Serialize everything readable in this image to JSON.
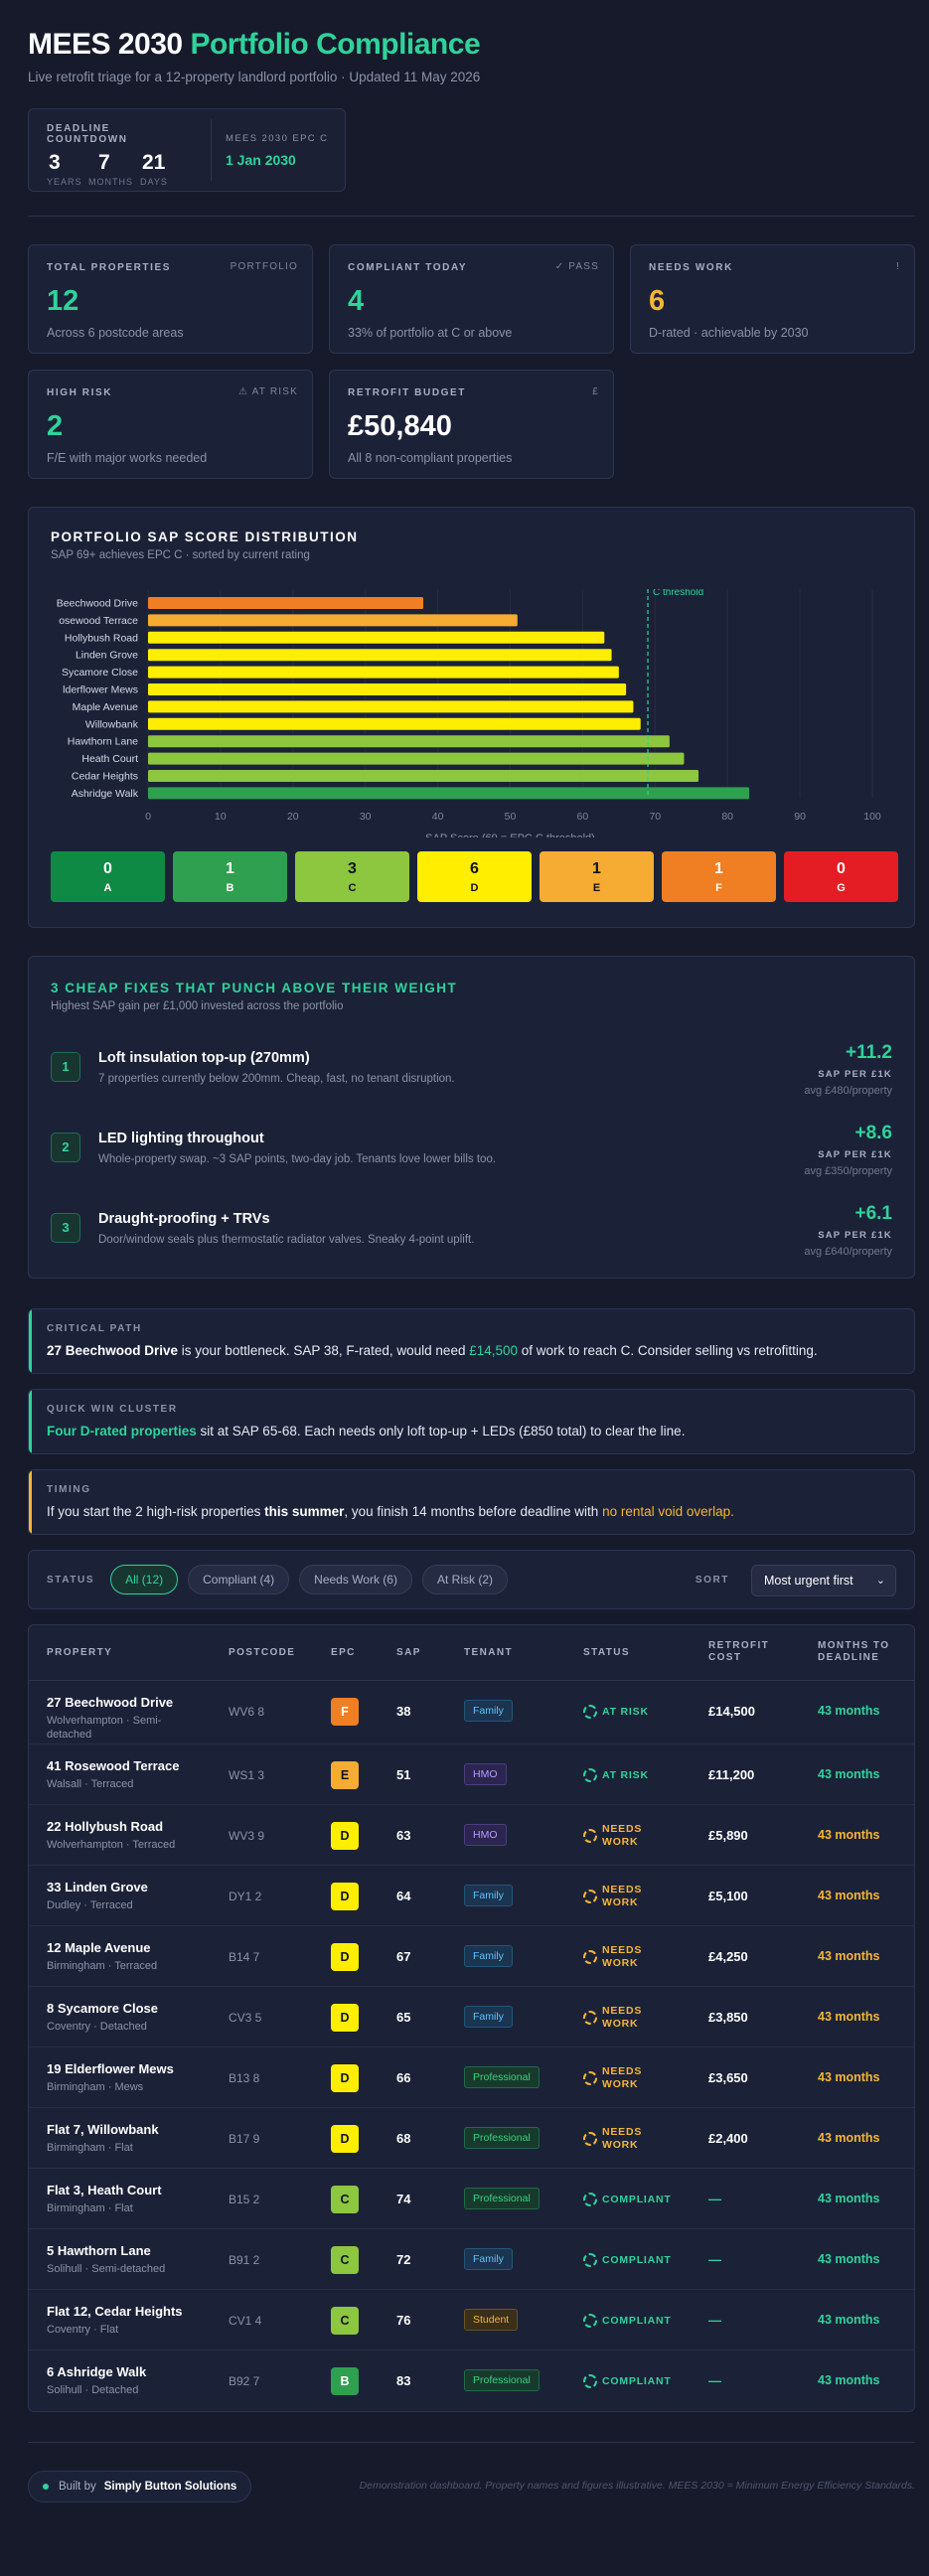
{
  "header": {
    "title_prefix": "MEES 2030",
    "title_accent": "Portfolio Compliance",
    "subtitle": "Live retrofit triage for a 12-property landlord portfolio · Updated 11 May 2026"
  },
  "countdown": {
    "label": "DEADLINE COUNTDOWN",
    "years": "3",
    "years_label": "YEARS",
    "months": "7",
    "months_label": "MONTHS",
    "days": "21",
    "days_label": "DAYS",
    "target_label": "MEES 2030 EPC C",
    "target_date": "1 Jan 2030"
  },
  "stats": [
    {
      "label": "TOTAL PROPERTIES",
      "tag": "PORTFOLIO",
      "value": "12",
      "note": "Across 6 postcode areas",
      "color": "#2fd39a"
    },
    {
      "label": "COMPLIANT TODAY",
      "tag": "✓ PASS",
      "value": "4",
      "note": "33% of portfolio at C or above",
      "color": "#2fd39a"
    },
    {
      "label": "NEEDS WORK",
      "tag": "!",
      "value": "6",
      "note": "D-rated · achievable by 2030",
      "color": "#f6b533"
    },
    {
      "label": "HIGH RISK",
      "tag": "⚠ AT RISK",
      "value": "2",
      "note": "F/E with major works needed",
      "color": "#2fd39a"
    },
    {
      "label": "RETROFIT BUDGET",
      "tag": "£",
      "value": "£50,840",
      "note": "All 8 non-compliant properties",
      "color": "#ffffff"
    }
  ],
  "distribution": {
    "title": "PORTFOLIO SAP SCORE DISTRIBUTION",
    "subtitle": "SAP 69+ achieves EPC C · sorted by current rating",
    "bands": [
      {
        "count": "0",
        "label": "A",
        "bg": "#0f8a45",
        "fg": "#ffffff"
      },
      {
        "count": "1",
        "label": "B",
        "bg": "#2ea04f",
        "fg": "#ffffff"
      },
      {
        "count": "3",
        "label": "C",
        "bg": "#8dc63f",
        "fg": "#10131f"
      },
      {
        "count": "6",
        "label": "D",
        "bg": "#ffee00",
        "fg": "#10131f"
      },
      {
        "count": "1",
        "label": "E",
        "bg": "#f6ac32",
        "fg": "#10131f"
      },
      {
        "count": "1",
        "label": "F",
        "bg": "#ef7f22",
        "fg": "#ffffff"
      },
      {
        "count": "0",
        "label": "G",
        "bg": "#e31d23",
        "fg": "#ffffff"
      }
    ]
  },
  "chart_data": {
    "type": "bar",
    "orientation": "horizontal",
    "categories": [
      "27 Beechwood Drive",
      "41 Rosewood Terrace",
      "22 Hollybush Road",
      "33 Linden Grove",
      "8 Sycamore Close",
      "19 Elderflower Mews",
      "12 Maple Avenue",
      "Flat 7, Willowbank",
      "5 Hawthorn Lane",
      "Flat 3, Heath Court",
      "Flat 12, Cedar Heights",
      "6 Ashridge Walk"
    ],
    "tick_labels": [
      "Beechwood Drive",
      "osewood Terrace",
      "Hollybush Road",
      "Linden Grove",
      "Sycamore Close",
      "lderflower Mews",
      "Maple Avenue",
      "Willowbank",
      "Hawthorn Lane",
      "Heath Court",
      "Cedar Heights",
      "Ashridge Walk"
    ],
    "values": [
      38,
      51,
      63,
      64,
      65,
      66,
      67,
      68,
      72,
      74,
      76,
      83
    ],
    "colors": [
      "#ef7f22",
      "#f6ac32",
      "#ffee00",
      "#ffee00",
      "#ffee00",
      "#ffee00",
      "#ffee00",
      "#ffee00",
      "#8dc63f",
      "#8dc63f",
      "#8dc63f",
      "#2ea04f"
    ],
    "xlabel": "SAP Score (69 = EPC C threshold)",
    "xlim": [
      0,
      100
    ],
    "xticks": [
      0,
      10,
      20,
      30,
      40,
      50,
      60,
      70,
      80,
      90,
      100
    ],
    "threshold": {
      "value": 69,
      "label": "C threshold",
      "color": "#2fd39a"
    },
    "grid": true
  },
  "fixes": {
    "title": "3 CHEAP FIXES THAT PUNCH ABOVE THEIR WEIGHT",
    "subtitle": "Highest SAP gain per £1,000 invested across the portfolio",
    "items": [
      {
        "num": "1",
        "name": "Loft insulation top-up (270mm)",
        "desc": "7 properties currently below 200mm. Cheap, fast, no tenant disruption.",
        "gain": "+11.2",
        "per": "SAP PER £1K",
        "avg": "avg £480/property"
      },
      {
        "num": "2",
        "name": "LED lighting throughout",
        "desc": "Whole-property swap. ~3 SAP points, two-day job. Tenants love lower bills too.",
        "gain": "+8.6",
        "per": "SAP PER £1K",
        "avg": "avg £350/property"
      },
      {
        "num": "3",
        "name": "Draught-proofing + TRVs",
        "desc": "Door/window seals plus thermostatic radiator valves. Sneaky 4-point uplift.",
        "gain": "+6.1",
        "per": "SAP PER £1K",
        "avg": "avg £640/property"
      }
    ]
  },
  "callouts": {
    "critical": {
      "label": "CRITICAL PATH",
      "p1": "27 Beechwood Drive",
      "p2": " is your bottleneck. SAP 38, F-rated, would need ",
      "p3": "£14,500",
      "p4": " of work to reach C. Consider selling vs retrofitting."
    },
    "quick": {
      "label": "QUICK WIN CLUSTER",
      "p1": "Four D-rated properties",
      "p2": " sit at SAP 65-68. Each needs only loft top-up + LEDs (£850 total) to clear the line."
    },
    "timing": {
      "label": "TIMING",
      "p1": "If you start the 2 high-risk properties ",
      "p2": "this summer",
      "p3": ", you finish 14 months before deadline with ",
      "p4": "no rental void overlap."
    }
  },
  "filters": {
    "label": "STATUS",
    "pills": [
      "All (12)",
      "Compliant (4)",
      "Needs Work (6)",
      "At Risk (2)"
    ],
    "sort_label": "SORT",
    "sort_value": "Most urgent first"
  },
  "table": {
    "headers": [
      "PROPERTY",
      "POSTCODE",
      "EPC",
      "SAP",
      "TENANT",
      "STATUS",
      "RETROFIT COST",
      "MONTHS TO DEADLINE"
    ],
    "rows": [
      {
        "name": "27 Beechwood Drive",
        "loc": "Wolverhampton · Semi-detached",
        "postcode": "WV6 8",
        "epc": "F",
        "sap": "38",
        "tenant": "Family",
        "status": "AT RISK",
        "cost": "£14,500",
        "months": "43 months"
      },
      {
        "name": "41 Rosewood Terrace",
        "loc": "Walsall · Terraced",
        "postcode": "WS1 3",
        "epc": "E",
        "sap": "51",
        "tenant": "HMO",
        "status": "AT RISK",
        "cost": "£11,200",
        "months": "43 months"
      },
      {
        "name": "22 Hollybush Road",
        "loc": "Wolverhampton · Terraced",
        "postcode": "WV3 9",
        "epc": "D",
        "sap": "63",
        "tenant": "HMO",
        "status": "NEEDS WORK",
        "cost": "£5,890",
        "months": "43 months"
      },
      {
        "name": "33 Linden Grove",
        "loc": "Dudley · Terraced",
        "postcode": "DY1 2",
        "epc": "D",
        "sap": "64",
        "tenant": "Family",
        "status": "NEEDS WORK",
        "cost": "£5,100",
        "months": "43 months"
      },
      {
        "name": "12 Maple Avenue",
        "loc": "Birmingham · Terraced",
        "postcode": "B14 7",
        "epc": "D",
        "sap": "67",
        "tenant": "Family",
        "status": "NEEDS WORK",
        "cost": "£4,250",
        "months": "43 months"
      },
      {
        "name": "8 Sycamore Close",
        "loc": "Coventry · Detached",
        "postcode": "CV3 5",
        "epc": "D",
        "sap": "65",
        "tenant": "Family",
        "status": "NEEDS WORK",
        "cost": "£3,850",
        "months": "43 months"
      },
      {
        "name": "19 Elderflower Mews",
        "loc": "Birmingham · Mews",
        "postcode": "B13 8",
        "epc": "D",
        "sap": "66",
        "tenant": "Professional",
        "status": "NEEDS WORK",
        "cost": "£3,650",
        "months": "43 months"
      },
      {
        "name": "Flat 7, Willowbank",
        "loc": "Birmingham · Flat",
        "postcode": "B17 9",
        "epc": "D",
        "sap": "68",
        "tenant": "Professional",
        "status": "NEEDS WORK",
        "cost": "£2,400",
        "months": "43 months"
      },
      {
        "name": "Flat 3, Heath Court",
        "loc": "Birmingham · Flat",
        "postcode": "B15 2",
        "epc": "C",
        "sap": "74",
        "tenant": "Professional",
        "status": "COMPLIANT",
        "cost": "—",
        "months": "43 months"
      },
      {
        "name": "5 Hawthorn Lane",
        "loc": "Solihull · Semi-detached",
        "postcode": "B91 2",
        "epc": "C",
        "sap": "72",
        "tenant": "Family",
        "status": "COMPLIANT",
        "cost": "—",
        "months": "43 months"
      },
      {
        "name": "Flat 12, Cedar Heights",
        "loc": "Coventry · Flat",
        "postcode": "CV1 4",
        "epc": "C",
        "sap": "76",
        "tenant": "Student",
        "status": "COMPLIANT",
        "cost": "—",
        "months": "43 months"
      },
      {
        "name": "6 Ashridge Walk",
        "loc": "Solihull · Detached",
        "postcode": "B92 7",
        "epc": "B",
        "sap": "83",
        "tenant": "Professional",
        "status": "COMPLIANT",
        "cost": "—",
        "months": "43 months"
      }
    ]
  },
  "footer": {
    "built_by": "Built by",
    "company": "Simply Button Solutions",
    "disclaimer": "Demonstration dashboard. Property names and figures illustrative. MEES 2030 = Minimum Energy Efficiency Standards."
  }
}
